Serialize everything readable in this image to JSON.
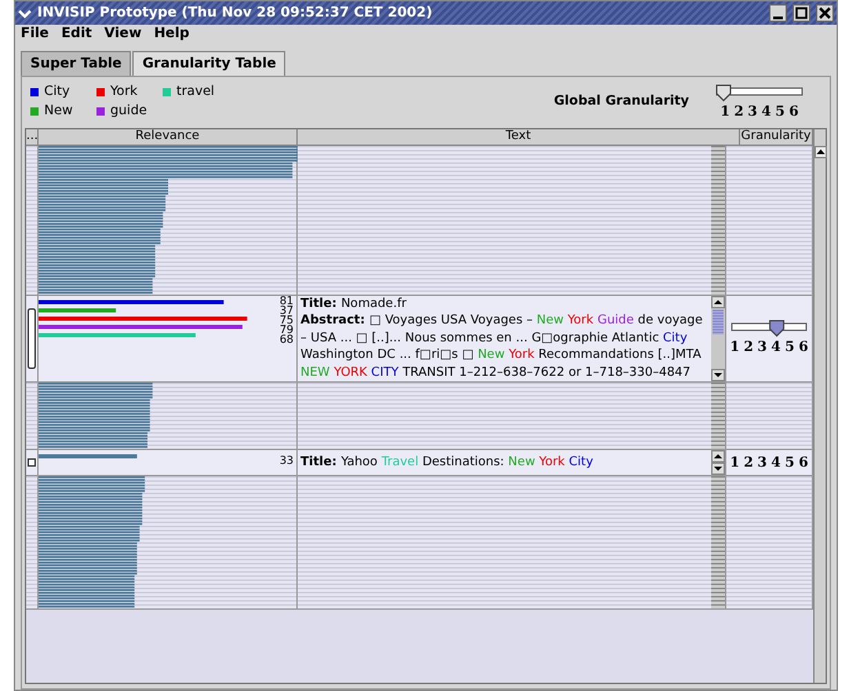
{
  "window": {
    "title": "INVISIP Prototype (Thu Nov 28 09:52:37 CET 2002)"
  },
  "menu": [
    "File",
    "Edit",
    "View",
    "Help"
  ],
  "tabs": [
    {
      "label": "Super Table",
      "selected": false
    },
    {
      "label": "Granularity Table",
      "selected": true
    }
  ],
  "legend": [
    {
      "label": "City",
      "color": "#0000dd"
    },
    {
      "label": "York",
      "color": "#ee0000"
    },
    {
      "label": "travel",
      "color": "#22cc99"
    },
    {
      "label": "New",
      "color": "#22aa22"
    },
    {
      "label": "guide",
      "color": "#9922dd"
    }
  ],
  "global_granularity": {
    "label": "Global Granularity",
    "level": 0,
    "ticks": [
      "1",
      "2",
      "3",
      "4",
      "5",
      "6"
    ]
  },
  "table": {
    "columns": [
      "...",
      "Relevance",
      "Text",
      "Granularity"
    ],
    "rows": [
      {
        "kind": "compressed"
      },
      {
        "kind": "expanded",
        "checked": false,
        "scores": [
          {
            "color": "#0000dd",
            "value": "81",
            "level": 0.79
          },
          {
            "color": "#22aa22",
            "value": "37",
            "level": 0.33
          },
          {
            "color": "#ee0000",
            "value": "75",
            "level": 0.89
          },
          {
            "color": "#9922dd",
            "value": "79",
            "level": 0.87
          },
          {
            "color": "#22cc99",
            "value": "68",
            "level": 0.67
          }
        ],
        "title_label": "Title:",
        "title": [
          {
            "text": "Nomade.fr"
          }
        ],
        "abstract_label": "Abstract:",
        "abstract": [
          {
            "text": "□ Voyages USA Voyages – "
          },
          {
            "text": "New",
            "color": "#22aa22"
          },
          {
            "text": " York",
            "color": "#ee0000"
          },
          {
            "text": " Guide",
            "color": "#9922dd"
          },
          {
            "text": " de voyage – USA ... □ [..]... Nous sommes en ... G□ographie Atlantic "
          },
          {
            "text": "City",
            "color": "#0000dd"
          },
          {
            "text": " Washington DC ... f□ri□s □ "
          },
          {
            "text": "New",
            "color": "#22aa22"
          },
          {
            "text": " York",
            "color": "#ee0000"
          },
          {
            "text": " Recommandations [..]MTA "
          },
          {
            "text": "NEW",
            "color": "#22aa22"
          },
          {
            "text": " YORK",
            "color": "#ee0000"
          },
          {
            "text": " CITY",
            "color": "#0000dd"
          },
          {
            "text": " TRANSIT 1–212–638–7622 or 1–718–330–4847"
          }
        ],
        "granularity": {
          "level": 0.6,
          "ticks": [
            "1",
            "2",
            "3",
            "4",
            "5",
            "6"
          ]
        }
      },
      {
        "kind": "compressed"
      },
      {
        "kind": "title_only",
        "checked": false,
        "scores": [
          {
            "value": "33",
            "level": 0.42
          }
        ],
        "title_label": "Title:",
        "title": [
          {
            "text": "Yahoo "
          },
          {
            "text": "Travel",
            "color": "#22cc99"
          },
          {
            "text": " Destinations: "
          },
          {
            "text": "New",
            "color": "#22aa22"
          },
          {
            "text": " York",
            "color": "#ee0000"
          },
          {
            "text": " City",
            "color": "#0000dd"
          }
        ],
        "granularity": {
          "ticks": [
            "1",
            "2",
            "3",
            "4",
            "5",
            "6"
          ]
        }
      },
      {
        "kind": "compressed"
      }
    ]
  }
}
